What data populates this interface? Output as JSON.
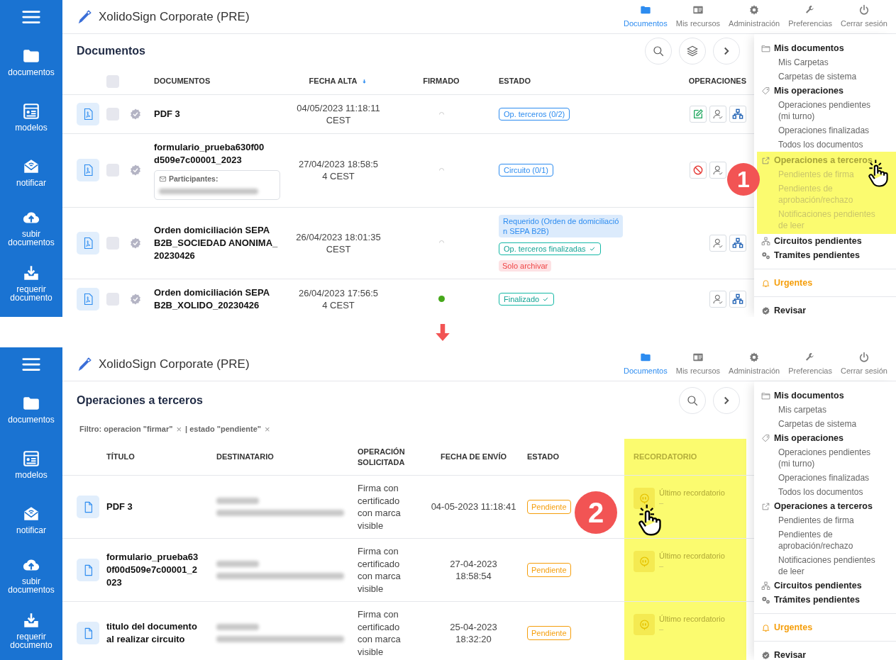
{
  "screens": [
    {
      "kind": "documents",
      "step_badge": "1",
      "sidebar": [
        {
          "kind": "folder",
          "label": "documentos"
        },
        {
          "kind": "template",
          "label": "modelos"
        },
        {
          "kind": "mail",
          "label": "notificar"
        },
        {
          "kind": "upload",
          "label": "subir documentos"
        },
        {
          "kind": "download",
          "label": "requerir documento"
        }
      ],
      "app_title": "XolidoSign Corporate (PRE)",
      "nav": [
        {
          "kind": "folder",
          "label": "Documentos",
          "selected": true
        },
        {
          "kind": "card",
          "label": "Mis recursos",
          "selected": false
        },
        {
          "kind": "gear",
          "label": "Administración",
          "selected": false
        },
        {
          "kind": "wrench",
          "label": "Preferencias",
          "selected": false
        },
        {
          "kind": "power",
          "label": "Cerrar sesión",
          "selected": false
        }
      ],
      "page_title": "Documentos",
      "toolbar": [
        {
          "kind": "search"
        },
        {
          "kind": "layers"
        },
        {
          "kind": "next"
        }
      ],
      "table": {
        "all_checked": false,
        "columns": [
          {
            "label": "DOCUMENTOS",
            "sorted": false
          },
          {
            "label": "FECHA ALTA",
            "sorted": true
          },
          {
            "label": "FIRMADO",
            "sorted": false
          },
          {
            "label": "ESTADO",
            "sorted": false
          },
          {
            "label": "OPERACIONES",
            "sorted": false
          }
        ],
        "rows": [
          {
            "checked": false,
            "name": "PDF 3",
            "date": "04/05/2023 11:18:11\nCEST",
            "signed": false,
            "tags": [
              {
                "kind": "info",
                "label": "Op. terceros (0/2)"
              }
            ],
            "operations": [
              {
                "kind": "edit"
              },
              {
                "kind": "user"
              },
              {
                "kind": "circuit"
              }
            ]
          },
          {
            "checked": false,
            "name": "formulario_prueba630f00\nd509e7c00001_2023",
            "participants": "Participantes:",
            "date": "27/04/2023 18:58:5\n4 CEST",
            "signed": false,
            "tags": [
              {
                "kind": "info",
                "label": "Circuito (0/1)"
              }
            ],
            "operations": [
              {
                "kind": "block"
              },
              {
                "kind": "user"
              }
            ]
          },
          {
            "checked": false,
            "name": "Orden domiciliación SEPA\nB2B_SOCIEDAD ANONIMA_\n20230426",
            "date": "26/04/2023 18:01:35\nCEST",
            "signed": false,
            "tags": [
              {
                "kind": "request",
                "label": "Requerido (Orden de domiciliació\nn SEPA B2B)"
              },
              {
                "kind": "done",
                "label": "Op. terceros finalizadas"
              },
              {
                "kind": "warning",
                "label": "Solo archivar"
              }
            ],
            "operations": [
              {
                "kind": "user"
              },
              {
                "kind": "circuit"
              }
            ]
          },
          {
            "checked": false,
            "name": "Orden domiciliación SEPA\nB2B_XOLIDO_20230426",
            "date": "26/04/2023 17:56:5\n4 CEST",
            "signed": true,
            "tags": [
              {
                "kind": "done",
                "label": "Finalizado"
              }
            ],
            "operations": [
              {
                "kind": "user"
              },
              {
                "kind": "circuit"
              }
            ]
          }
        ]
      },
      "menu": [
        {
          "kind": "documents",
          "label": "Mis documentos",
          "highlighted": false,
          "children": [
            {
              "label": "Mis Carpetas"
            },
            {
              "label": "Carpetas de sistema"
            }
          ]
        },
        {
          "kind": "operations",
          "label": "Mis operaciones",
          "highlighted": false,
          "children": [
            {
              "label": "Operaciones pendientes\n(mi turno)"
            },
            {
              "label": "Operaciones finalizadas"
            },
            {
              "label": "Todos los documentos"
            }
          ]
        },
        {
          "kind": "third",
          "label": "Operaciones a terceros",
          "highlighted": true,
          "children": [
            {
              "label": "Pendientes de firma"
            },
            {
              "label": "Pendientes de\naprobación/rechazo"
            },
            {
              "label": "Notificaciones pendientes\nde leer"
            }
          ]
        },
        {
          "kind": "circuits",
          "label": "Circuitos pendientes",
          "highlighted": false
        },
        {
          "kind": "procedures",
          "label": "Tramites pendientes",
          "highlighted": false
        },
        {
          "kind": "urgent",
          "label": "Urgentes",
          "highlighted": false
        },
        {
          "kind": "review",
          "label": "Revisar",
          "highlighted": false
        }
      ]
    },
    {
      "kind": "third-party",
      "step_badge": "2",
      "sidebar": [
        {
          "kind": "folder",
          "label": "documentos"
        },
        {
          "kind": "template",
          "label": "modelos"
        },
        {
          "kind": "mail",
          "label": "notificar"
        },
        {
          "kind": "upload",
          "label": "subir documentos"
        },
        {
          "kind": "download",
          "label": "requerir documento"
        }
      ],
      "app_title": "XolidoSign Corporate (PRE)",
      "nav": [
        {
          "kind": "folder",
          "label": "Documentos",
          "selected": true
        },
        {
          "kind": "card",
          "label": "Mis recursos",
          "selected": false
        },
        {
          "kind": "gear",
          "label": "Administración",
          "selected": false
        },
        {
          "kind": "wrench",
          "label": "Preferencias",
          "selected": false
        },
        {
          "kind": "power",
          "label": "Cerrar sesión",
          "selected": false
        }
      ],
      "page_title": "Operaciones a terceros",
      "toolbar": [
        {
          "kind": "search"
        },
        {
          "kind": "next"
        }
      ],
      "filters": [
        {
          "label": "Filtro: operacion \"firmar\"",
          "remove": "×"
        },
        {
          "label": "| estado \"pendiente\"",
          "remove": "×"
        }
      ],
      "table": {
        "columns": [
          {
            "label": "TÍTULO",
            "highlighted": false
          },
          {
            "label": "DESTINATARIO",
            "highlighted": false
          },
          {
            "label": "OPERACIÓN\nSOLICITADA",
            "highlighted": false
          },
          {
            "label": "FECHA DE ENVÍO",
            "highlighted": false
          },
          {
            "label": "ESTADO",
            "highlighted": false
          },
          {
            "label": "RECORDATORIO",
            "highlighted": true
          }
        ],
        "rows": [
          {
            "title": "PDF 3",
            "operation": "Firma con\ncertificado\ncon marca\nvisible",
            "date": "04-05-2023 11:18:41",
            "status": "Pendiente",
            "reminder_label": "Último recordatorio",
            "reminder_value": "–"
          },
          {
            "title": "formulario_prueba63\n0f00d509e7c00001_2\n023",
            "operation": "Firma con\ncertificado\ncon marca\nvisible",
            "date": "27-04-2023\n18:58:54",
            "status": "Pendiente",
            "reminder_label": "Último recordatorio",
            "reminder_value": "–"
          },
          {
            "title": "titulo del documento\nal realizar circuito",
            "operation": "Firma con\ncertificado\ncon marca\nvisible",
            "date": "25-04-2023\n18:32:20",
            "status": "Pendiente",
            "reminder_label": "Último recordatorio",
            "reminder_value": "–"
          }
        ]
      },
      "menu": [
        {
          "kind": "documents",
          "label": "Mis documentos",
          "highlighted": false,
          "children": [
            {
              "label": "Mis carpetas"
            },
            {
              "label": "Carpetas de sistema"
            }
          ]
        },
        {
          "kind": "operations",
          "label": "Mis operaciones",
          "highlighted": false,
          "children": [
            {
              "label": "Operaciones pendientes\n(mi turno)"
            },
            {
              "label": "Operaciones finalizadas"
            },
            {
              "label": "Todos los documentos"
            }
          ]
        },
        {
          "kind": "third",
          "label": "Operaciones a terceros",
          "highlighted": false,
          "children": [
            {
              "label": "Pendientes de firma"
            },
            {
              "label": "Pendientes de\naprobación/rechazo"
            },
            {
              "label": "Notificaciones pendientes\nde leer"
            }
          ]
        },
        {
          "kind": "circuits",
          "label": "Circuitos pendientes",
          "highlighted": false
        },
        {
          "kind": "procedures",
          "label": "Trámites pendientes",
          "highlighted": false
        },
        {
          "kind": "urgent",
          "label": "Urgentes",
          "highlighted": false
        },
        {
          "kind": "review",
          "label": "Revisar",
          "highlighted": false
        }
      ]
    }
  ]
}
